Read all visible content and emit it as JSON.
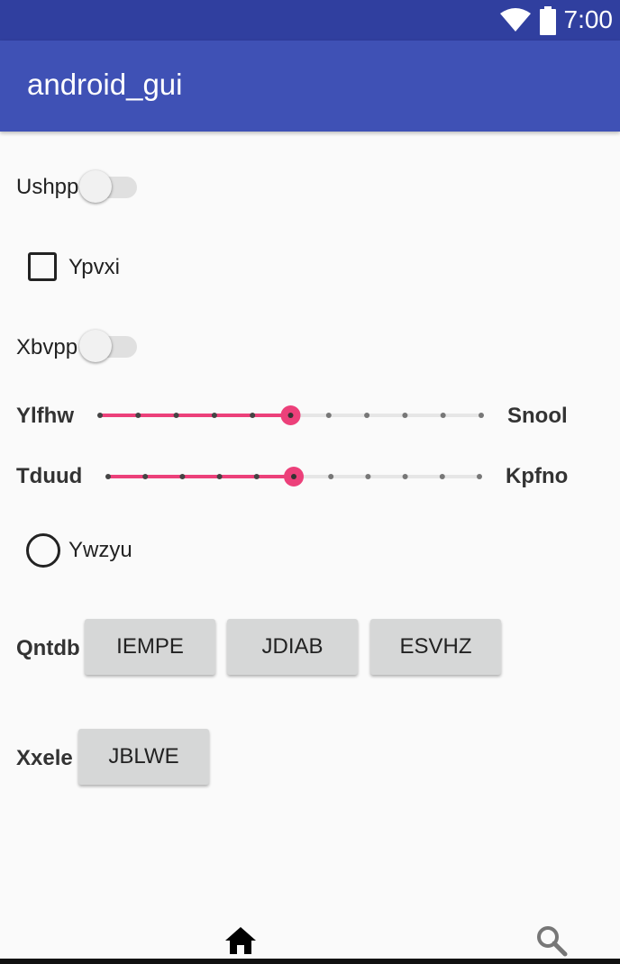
{
  "status_bar": {
    "time": "7:00",
    "icons": [
      "wifi-icon",
      "battery-icon"
    ]
  },
  "app_bar": {
    "title": "android_gui"
  },
  "colors": {
    "primary": "#3f51b5",
    "primary_dark": "#303f9f",
    "accent": "#ec407a",
    "background": "#fafafa",
    "button": "#d6d7d7"
  },
  "switch1": {
    "label": "Ushpp",
    "checked": false
  },
  "checkbox1": {
    "label": "Ypvxi",
    "checked": false
  },
  "switch2": {
    "label": "Xbvpp",
    "checked": false
  },
  "slider1": {
    "label_left": "Ylfhw",
    "label_right": "Snool",
    "value": 5,
    "max": 10
  },
  "slider2": {
    "label_left": "Tduud",
    "label_right": "Kpfno",
    "value": 5,
    "max": 10
  },
  "radio1": {
    "label": "Ywzyu",
    "checked": false
  },
  "button_group1": {
    "label": "Qntdb",
    "buttons": [
      "IEMPE",
      "JDIAB",
      "ESVHZ"
    ]
  },
  "button_group2": {
    "label": "Xxele",
    "buttons": [
      "JBLWE"
    ]
  },
  "bottom_nav": {
    "icons": [
      "home-icon",
      "search-icon"
    ]
  }
}
